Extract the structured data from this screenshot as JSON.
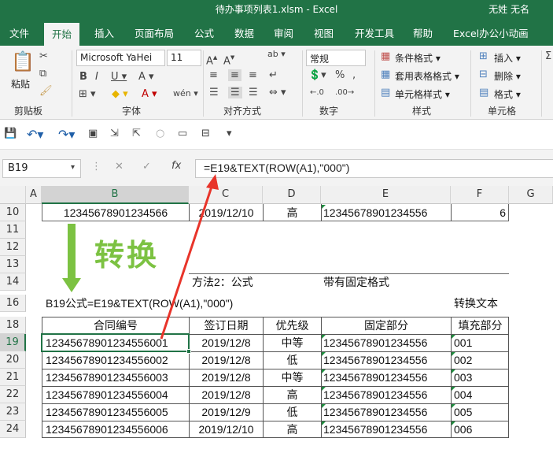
{
  "window": {
    "title": "待办事项列表1.xlsm  -  Excel",
    "user": "无姓 无名"
  },
  "tabs": [
    "文件",
    "开始",
    "插入",
    "页面布局",
    "公式",
    "数据",
    "审阅",
    "视图",
    "开发工具",
    "帮助",
    "Excel办公小动画"
  ],
  "ribbon": {
    "font_name": "Microsoft YaHei",
    "font_size": "11",
    "number_format": "常规",
    "paste": "粘贴",
    "groups": [
      "剪贴板",
      "字体",
      "对齐方式",
      "数字",
      "样式",
      "单元格"
    ],
    "styles": [
      "条件格式 ▾",
      "套用表格格式 ▾",
      "单元格样式 ▾"
    ],
    "cells": [
      "插入 ▾",
      "删除 ▾",
      "格式 ▾"
    ]
  },
  "formula_bar": {
    "name_box": "B19",
    "formula": "=E19&TEXT(ROW(A1),\"000\")"
  },
  "columns": [
    "A",
    "B",
    "C",
    "D",
    "E",
    "F",
    "G"
  ],
  "rows": [
    "10",
    "11",
    "12",
    "13",
    "14",
    "16",
    "18",
    "19",
    "20",
    "21",
    "22",
    "23",
    "24"
  ],
  "row10": {
    "b": "12345678901234566",
    "c": "2019/12/10",
    "d": "高",
    "e": "12345678901234556",
    "f": "6"
  },
  "annotations": {
    "convert": "转换",
    "method": "方法2：公式",
    "fixed_format": "带有固定格式",
    "b19_formula": "B19公式=E19&TEXT(ROW(A1),\"000\")",
    "convert_text": "转换文本"
  },
  "table": {
    "headers": [
      "合同编号",
      "签订日期",
      "优先级",
      "固定部分",
      "填充部分"
    ],
    "rows": [
      [
        "12345678901234556001",
        "2019/12/8",
        "中等",
        "12345678901234556",
        "001"
      ],
      [
        "12345678901234556002",
        "2019/12/8",
        "低",
        "12345678901234556",
        "002"
      ],
      [
        "12345678901234556003",
        "2019/12/8",
        "中等",
        "12345678901234556",
        "003"
      ],
      [
        "12345678901234556004",
        "2019/12/8",
        "高",
        "12345678901234556",
        "004"
      ],
      [
        "12345678901234556005",
        "2019/12/9",
        "低",
        "12345678901234556",
        "005"
      ],
      [
        "12345678901234556006",
        "2019/12/10",
        "高",
        "12345678901234556",
        "006"
      ]
    ]
  },
  "colors": {
    "excel_green": "#217346",
    "arrow_green": "#7cc242",
    "arrow_red": "#e8342a"
  }
}
